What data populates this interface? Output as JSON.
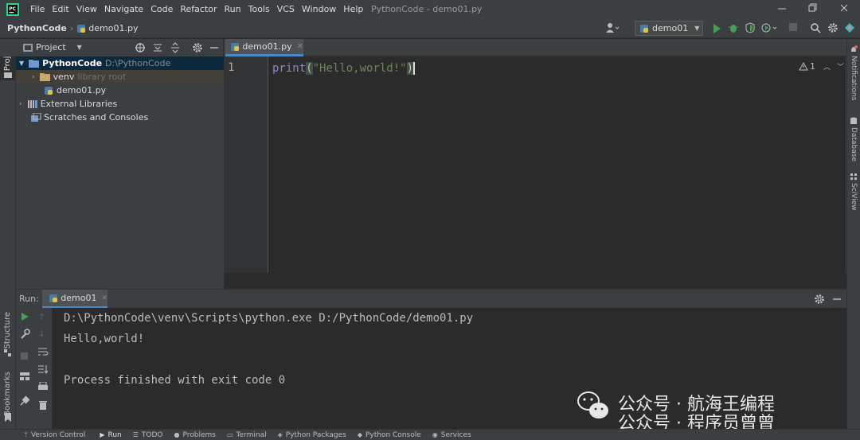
{
  "menu": {
    "items": [
      "File",
      "Edit",
      "View",
      "Navigate",
      "Code",
      "Refactor",
      "Run",
      "Tools",
      "VCS",
      "Window",
      "Help"
    ],
    "window_title": "PythonCode - demo01.py"
  },
  "navbar": {
    "project": "PythonCode",
    "file": "demo01.py",
    "run_config": "demo01"
  },
  "project_panel": {
    "title": "Project",
    "root_name": "PythonCode",
    "root_path": "D:\\PythonCode",
    "venv_name": "venv",
    "venv_note": "library root",
    "file": "demo01.py",
    "external": "External Libraries",
    "scratches": "Scratches and Consoles"
  },
  "left_strip": {
    "project": "Project",
    "structure": "Structure",
    "bookmarks": "Bookmarks"
  },
  "right_strip": {
    "notifications": "Notifications",
    "database": "Database",
    "sciview": "SciView"
  },
  "editor": {
    "tab": "demo01.py",
    "line_number": "1",
    "code_func": "print",
    "code_open": "(",
    "code_string": "\"Hello,world!\"",
    "code_close": ")",
    "warning_count": "1"
  },
  "run_panel": {
    "label": "Run:",
    "tab": "demo01",
    "lines": [
      "D:\\PythonCode\\venv\\Scripts\\python.exe D:/PythonCode/demo01.py",
      "Hello,world!",
      "",
      "Process finished with exit code 0"
    ]
  },
  "bottom_bar": {
    "items": [
      "Version Control",
      "Run",
      "TODO",
      "Problems",
      "Terminal",
      "Python Packages",
      "Python Console",
      "Services"
    ]
  },
  "watermark": {
    "line1": "公众号 · 航海王编程",
    "line2": "公众号 · 程序员曾曾"
  },
  "colors": {
    "bg_dark": "#2b2b2b",
    "panel": "#3c3f41",
    "run_green": "#499c54",
    "string": "#6a8759",
    "func": "#a9b7c6",
    "folder_blue": "#6e9ad0"
  }
}
